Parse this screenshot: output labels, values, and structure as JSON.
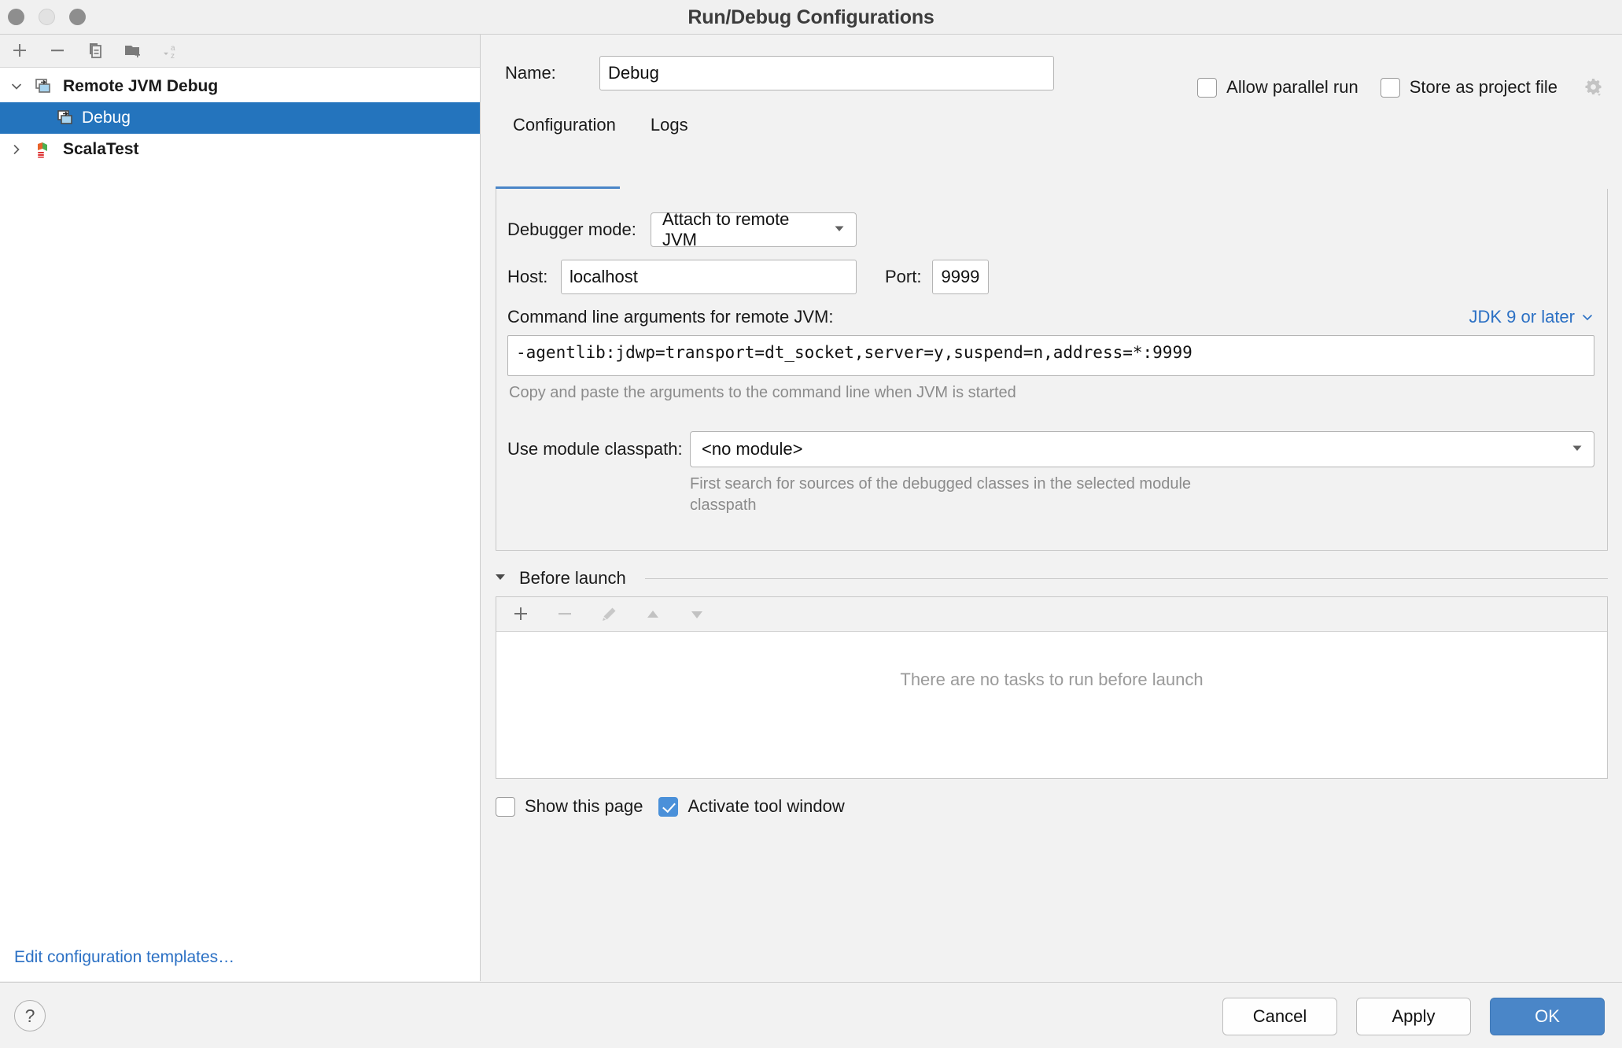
{
  "window": {
    "title": "Run/Debug Configurations",
    "traffic_lights": [
      "close-button",
      "minimize-button",
      "maximize-button"
    ]
  },
  "sidebar": {
    "toolbar": [
      {
        "name": "add-configuration-button",
        "icon": "plus-icon"
      },
      {
        "name": "remove-configuration-button",
        "icon": "minus-icon"
      },
      {
        "name": "copy-configuration-button",
        "icon": "copy-icon"
      },
      {
        "name": "new-folder-button",
        "icon": "folder-add-icon"
      },
      {
        "name": "sort-configurations-button",
        "icon": "sort-alpha-icon"
      }
    ],
    "tree": [
      {
        "label": "Remote JVM Debug",
        "level": 0,
        "expanded": true,
        "selected": false,
        "icon": "remote-debug-icon"
      },
      {
        "label": "Debug",
        "level": 1,
        "expanded": null,
        "selected": true,
        "icon": "remote-debug-icon"
      },
      {
        "label": "ScalaTest",
        "level": 0,
        "expanded": false,
        "selected": false,
        "icon": "scala-icon"
      }
    ],
    "edit_templates_label": "Edit configuration templates…"
  },
  "form": {
    "name_label": "Name:",
    "name_value": "Debug",
    "name_placeholder": "",
    "allow_parallel_run": {
      "label": "Allow parallel run",
      "checked": false
    },
    "store_as_project_file": {
      "label": "Store as project file",
      "checked": false,
      "gear": "gear-icon"
    }
  },
  "tabs": [
    {
      "label": "Configuration",
      "active": true
    },
    {
      "label": "Logs",
      "active": false
    }
  ],
  "configuration": {
    "debugger_mode_label": "Debugger mode:",
    "debugger_mode_value": "Attach to remote JVM",
    "host_label": "Host:",
    "host_value": "localhost",
    "port_label": "Port:",
    "port_value": "9999",
    "command_line_label": "Command line arguments for remote JVM:",
    "jdk_selector_label": "JDK 9 or later",
    "command_line_value": "-agentlib:jdwp=transport=dt_socket,server=y,suspend=n,address=*:9999",
    "command_line_hint": "Copy and paste the arguments to the command line when JVM is started",
    "module_classpath_label": "Use module classpath:",
    "module_classpath_value": "<no module>",
    "module_classpath_hint": "First search for sources of the debugged classes in the selected module classpath"
  },
  "before_launch": {
    "title": "Before launch",
    "expanded": true,
    "toolbar": [
      {
        "name": "add-task-button",
        "icon": "plus-icon",
        "enabled": true
      },
      {
        "name": "remove-task-button",
        "icon": "minus-icon",
        "enabled": false
      },
      {
        "name": "edit-task-button",
        "icon": "pencil-icon",
        "enabled": false
      },
      {
        "name": "move-task-up-button",
        "icon": "arrow-up-icon",
        "enabled": false
      },
      {
        "name": "move-task-down-button",
        "icon": "arrow-down-icon",
        "enabled": false
      }
    ],
    "empty_text": "There are no tasks to run before launch",
    "show_this_page": {
      "label": "Show this page",
      "checked": false
    },
    "activate_tool_window": {
      "label": "Activate tool window",
      "checked": true
    }
  },
  "footer": {
    "help_label": "?",
    "cancel_label": "Cancel",
    "apply_label": "Apply",
    "ok_label": "OK"
  },
  "colors": {
    "accent": "#4a86c8",
    "selection": "#2474bd",
    "link": "#2b70c4",
    "muted_text": "#8b8b8b",
    "window_bg": "#f2f2f2"
  }
}
